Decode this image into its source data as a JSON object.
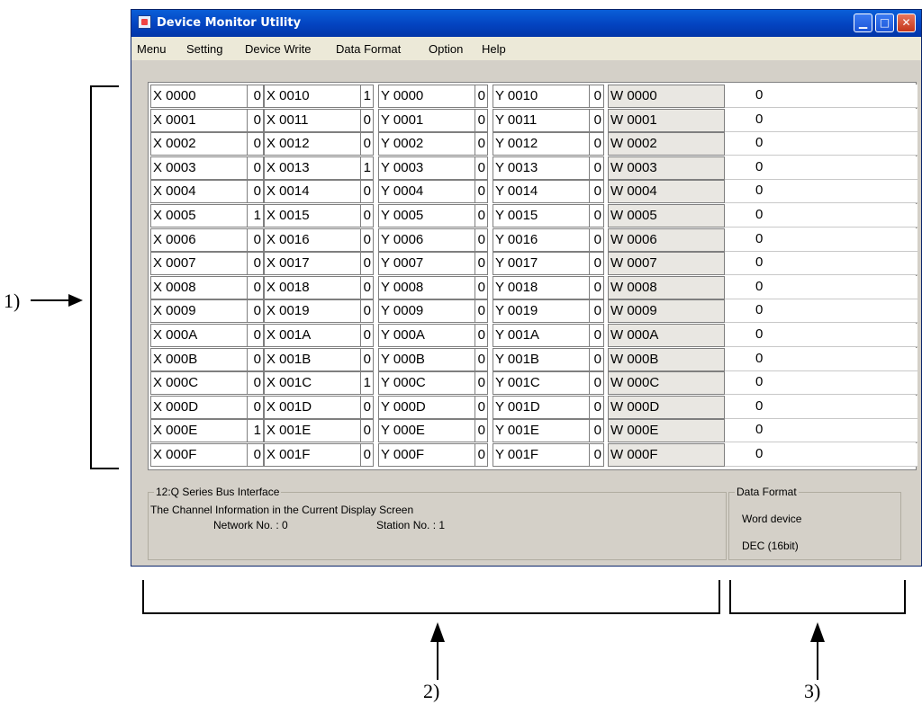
{
  "window": {
    "title": "Device Monitor Utility"
  },
  "menu": [
    "Menu",
    "Setting",
    "Device Write",
    "Data Format",
    "Option",
    "Help"
  ],
  "x_lo": {
    "labels": [
      "X 0000",
      "X 0001",
      "X 0002",
      "X 0003",
      "X 0004",
      "X 0005",
      "X 0006",
      "X 0007",
      "X 0008",
      "X 0009",
      "X 000A",
      "X 000B",
      "X 000C",
      "X 000D",
      "X 000E",
      "X 000F"
    ],
    "values": [
      "0",
      "0",
      "0",
      "0",
      "0",
      "1",
      "0",
      "0",
      "0",
      "0",
      "0",
      "0",
      "0",
      "0",
      "1",
      "0"
    ]
  },
  "x_hi": {
    "labels": [
      "X 0010",
      "X 0011",
      "X 0012",
      "X 0013",
      "X 0014",
      "X 0015",
      "X 0016",
      "X 0017",
      "X 0018",
      "X 0019",
      "X 001A",
      "X 001B",
      "X 001C",
      "X 001D",
      "X 001E",
      "X 001F"
    ],
    "values": [
      "1",
      "0",
      "0",
      "1",
      "0",
      "0",
      "0",
      "0",
      "0",
      "0",
      "0",
      "0",
      "1",
      "0",
      "0",
      "0"
    ]
  },
  "y_lo": {
    "labels": [
      "Y 0000",
      "Y 0001",
      "Y 0002",
      "Y 0003",
      "Y 0004",
      "Y 0005",
      "Y 0006",
      "Y 0007",
      "Y 0008",
      "Y 0009",
      "Y 000A",
      "Y 000B",
      "Y 000C",
      "Y 000D",
      "Y 000E",
      "Y 000F"
    ],
    "values": [
      "0",
      "0",
      "0",
      "0",
      "0",
      "0",
      "0",
      "0",
      "0",
      "0",
      "0",
      "0",
      "0",
      "0",
      "0",
      "0"
    ]
  },
  "y_hi": {
    "labels": [
      "Y 0010",
      "Y 0011",
      "Y 0012",
      "Y 0013",
      "Y 0014",
      "Y 0015",
      "Y 0016",
      "Y 0017",
      "Y 0018",
      "Y 0019",
      "Y 001A",
      "Y 001B",
      "Y 001C",
      "Y 001D",
      "Y 001E",
      "Y 001F"
    ],
    "values": [
      "0",
      "0",
      "0",
      "0",
      "0",
      "0",
      "0",
      "0",
      "0",
      "0",
      "0",
      "0",
      "0",
      "0",
      "0",
      "0"
    ]
  },
  "w": {
    "labels": [
      "W 0000",
      "W 0001",
      "W 0002",
      "W 0003",
      "W 0004",
      "W 0005",
      "W 0006",
      "W 0007",
      "W 0008",
      "W 0009",
      "W 000A",
      "W 000B",
      "W 000C",
      "W 000D",
      "W 000E",
      "W 000F"
    ],
    "values": [
      "0",
      "0",
      "0",
      "0",
      "0",
      "0",
      "0",
      "0",
      "0",
      "0",
      "0",
      "0",
      "0",
      "0",
      "0",
      "0"
    ]
  },
  "channel_info": {
    "group_title": "12:Q Series Bus Interface",
    "line1": "The Channel Information in the Current Display Screen",
    "network": "Network No. : 0",
    "station": "Station No. : 1"
  },
  "data_format": {
    "group_title": "Data Format",
    "device_type": "Word device",
    "format": "DEC (16bit)"
  },
  "annotations": [
    "1)",
    "2)",
    "3)"
  ]
}
